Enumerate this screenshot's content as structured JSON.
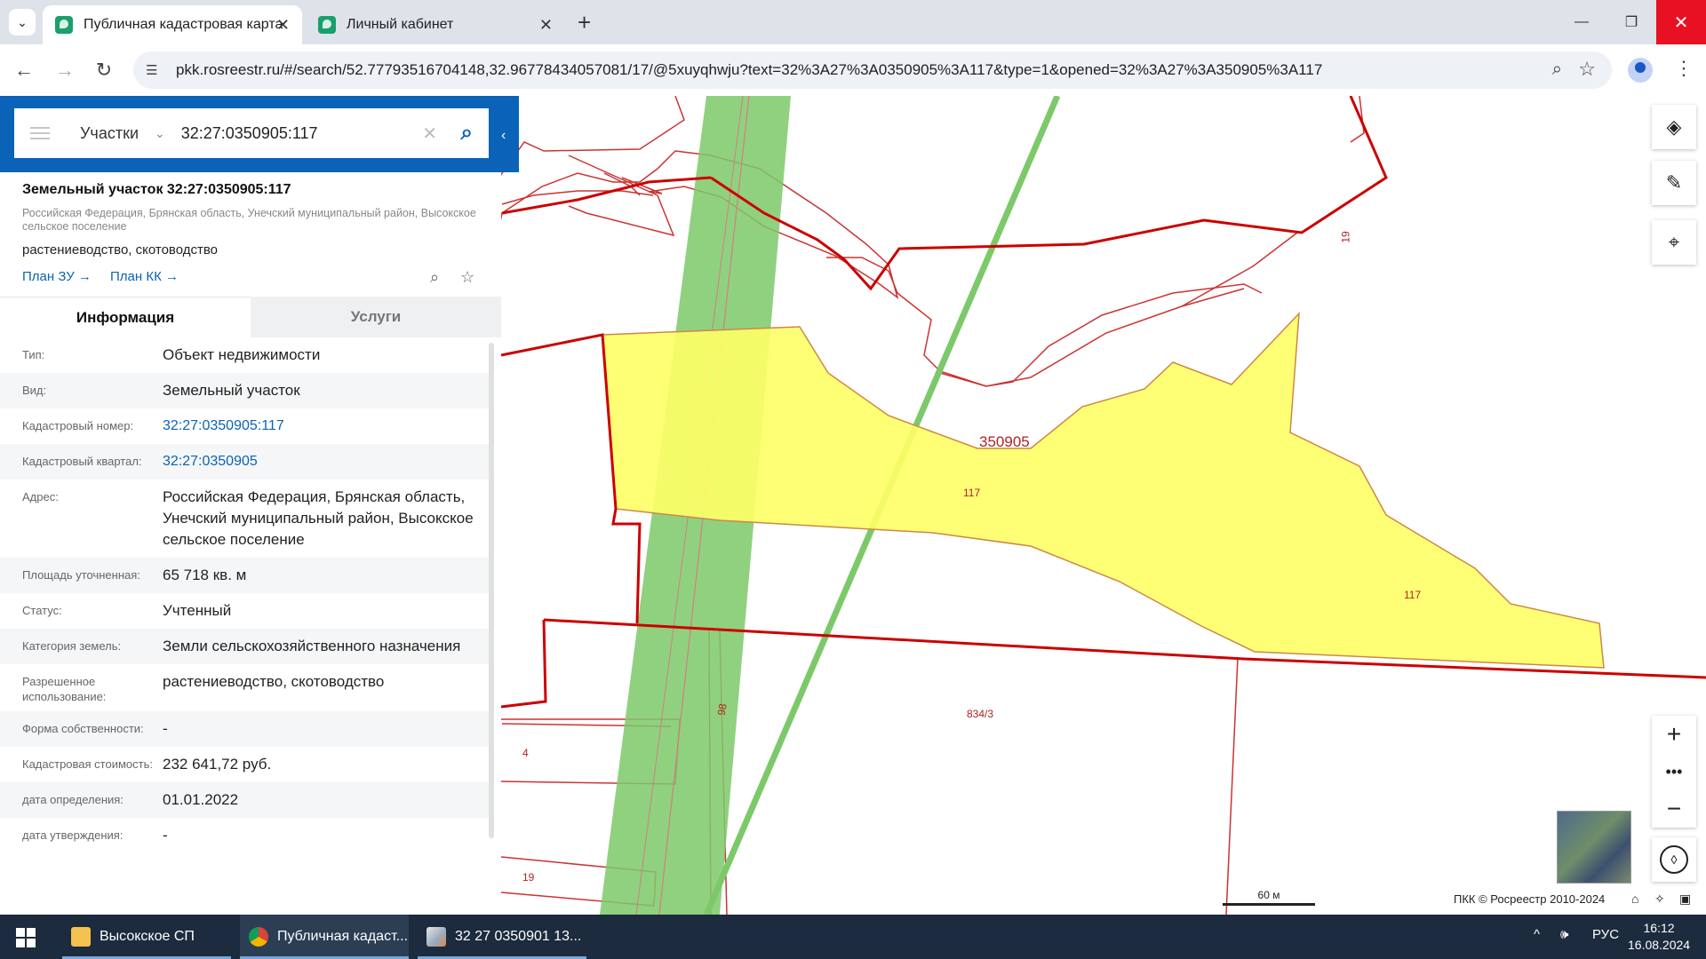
{
  "browser": {
    "tabs": [
      {
        "title": "Публичная кадастровая карта",
        "active": true
      },
      {
        "title": "Личный кабинет",
        "active": false
      }
    ],
    "url": "pkk.rosreestr.ru/#/search/52.77793516704148,32.96778434057081/17/@5xuyqhwju?text=32%3A27%3A0350905%3A117&type=1&opened=32%3A27%3A350905%3A117"
  },
  "search": {
    "selector": "Участки",
    "query": "32:27:0350905:117"
  },
  "parcel": {
    "title": "Земельный участок 32:27:0350905:117",
    "address_line": "Российская Федерация, Брянская область, Унечский муниципальный район, Высокское сельское поселение",
    "use": "растениеводство, скотоводство",
    "plan_zu": "План ЗУ",
    "plan_kk": "План КК"
  },
  "info_tabs": [
    "Информация",
    "Услуги"
  ],
  "rows": [
    {
      "label": "Тип:",
      "value": "Объект недвижимости"
    },
    {
      "label": "Вид:",
      "value": "Земельный участок"
    },
    {
      "label": "Кадастровый номер:",
      "value": "32:27:0350905:117",
      "link": true
    },
    {
      "label": "Кадастровый квартал:",
      "value": "32:27:0350905",
      "link": true
    },
    {
      "label": "Адрес:",
      "value": "Российская Федерация, Брянская область, Унечский муниципальный район, Высокское сельское поселение"
    },
    {
      "label": "Площадь уточненная:",
      "value": "65 718 кв. м"
    },
    {
      "label": "Статус:",
      "value": "Учтенный"
    },
    {
      "label": "Категория земель:",
      "value": "Земли сельскохозяйственного назначения"
    },
    {
      "label": "Разрешенное использование:",
      "value": "растениеводство, скотоводство"
    },
    {
      "label": "Форма собственности:",
      "value": "-"
    },
    {
      "label": "Кадастровая стоимость:",
      "value": "232 641,72 руб."
    },
    {
      "label": "дата определения:",
      "value": "01.01.2022"
    },
    {
      "label": "дата утверждения:",
      "value": "-"
    }
  ],
  "map": {
    "labels": {
      "quarter": "350905",
      "parcel_a": "117",
      "parcel_b": "117",
      "p19_top": "19",
      "p98": "98",
      "p834": "834/3",
      "p4": "4",
      "p19_bottom": "19"
    },
    "scale": "60 м",
    "copyright": "ПКК © Росреестр 2010-2024",
    "colors": {
      "parcel_fill": "#ffff66",
      "quarter_border": "#cc0000",
      "strip": "#7cc96a"
    }
  },
  "taskbar": {
    "items": [
      "Высокское СП",
      "Публичная кадаст...",
      "32  27  0350901  13..."
    ],
    "lang": "РУС",
    "time": "16:12",
    "date": "16.08.2024"
  }
}
